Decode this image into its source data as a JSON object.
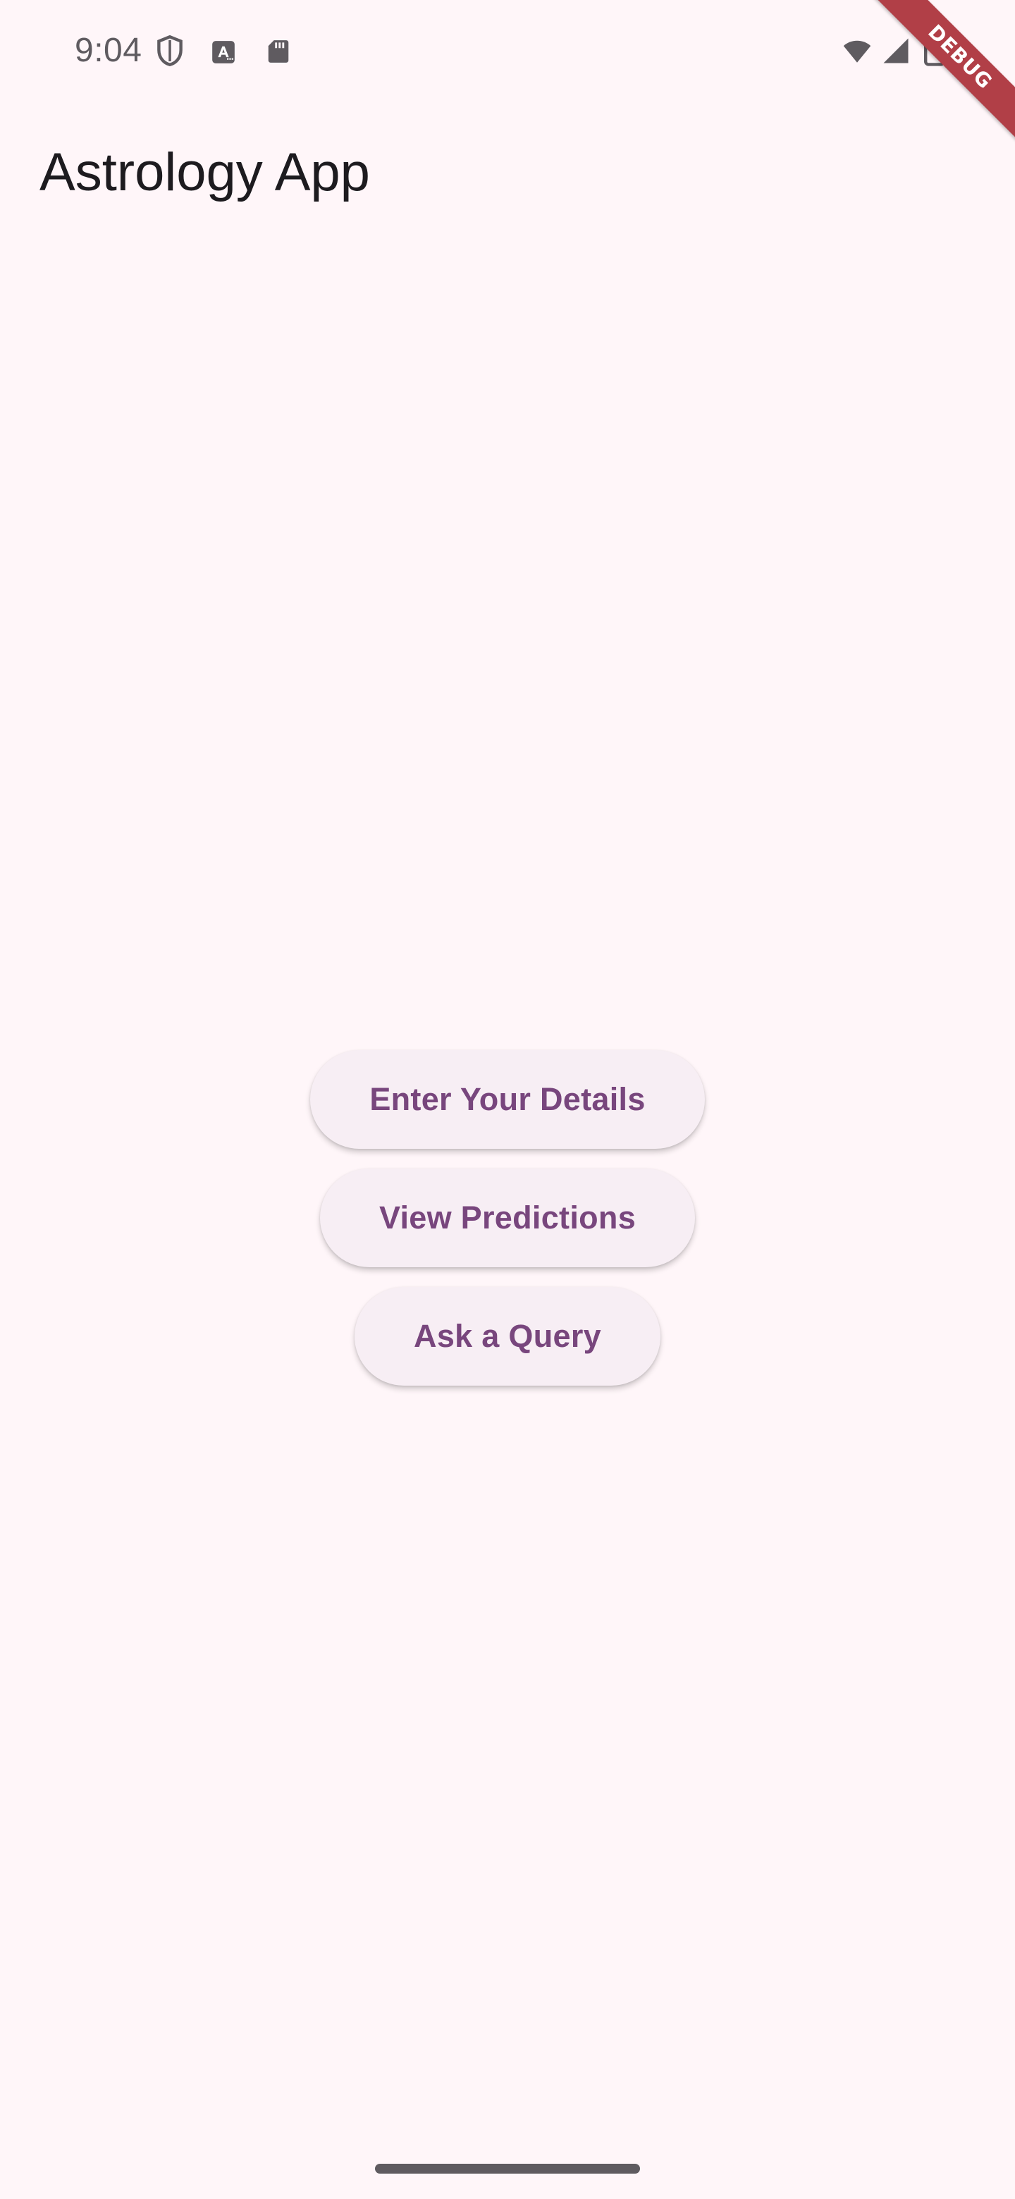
{
  "status_bar": {
    "time": "9:04",
    "icons": [
      "shield-icon",
      "a-badge-icon",
      "sdcard-icon",
      "wifi-icon",
      "signal-icon",
      "battery-icon"
    ]
  },
  "app_bar": {
    "title": "Astrology App"
  },
  "actions": {
    "enter_details_label": "Enter Your Details",
    "view_predictions_label": "View Predictions",
    "ask_query_label": "Ask a Query"
  },
  "debug_banner": {
    "label": "DEBUG"
  },
  "colors": {
    "background": "#fff6f9",
    "button_background": "#f7eef4",
    "button_text": "#78467d",
    "debug_banner": "#b13f47"
  }
}
